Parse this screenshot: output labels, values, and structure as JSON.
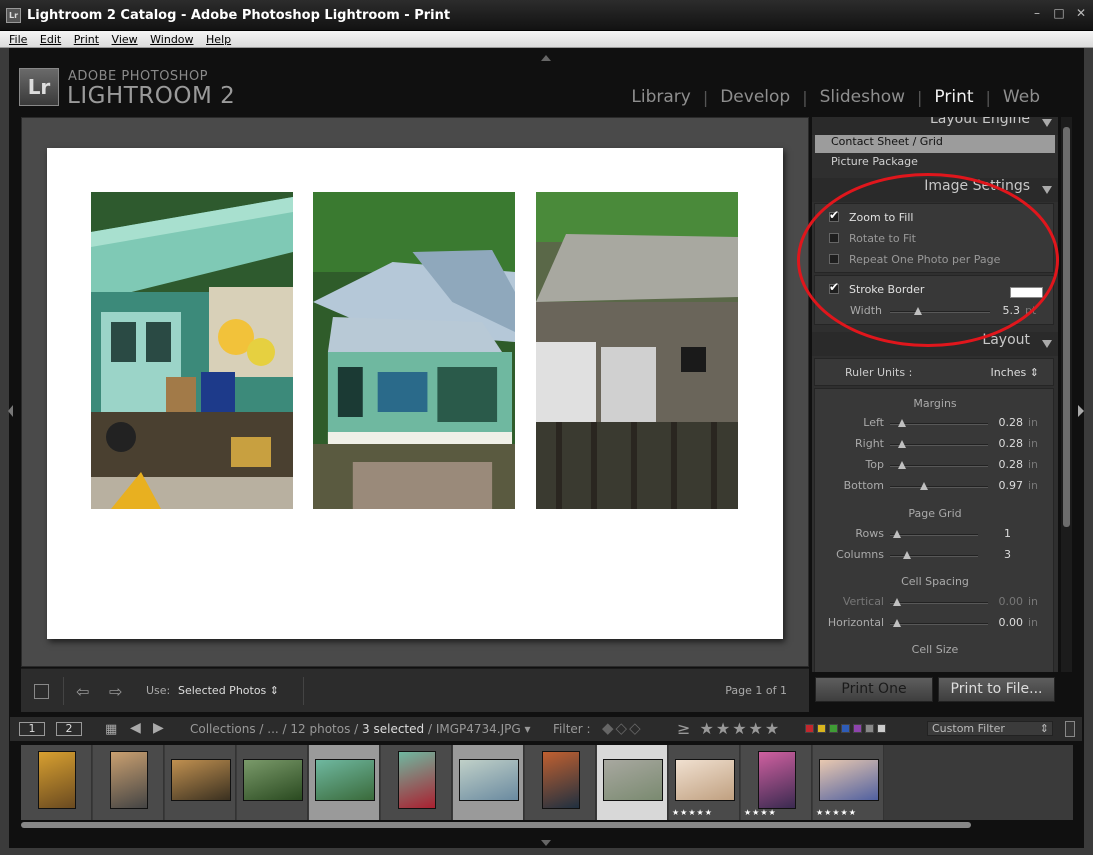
{
  "window": {
    "title": "Lightroom 2 Catalog - Adobe Photoshop Lightroom - Print",
    "app_icon": "Lr"
  },
  "menu": [
    "File",
    "Edit",
    "Print",
    "View",
    "Window",
    "Help"
  ],
  "identity": {
    "logo": "Lr",
    "line1": "ADOBE PHOTOSHOP",
    "line2": "LIGHTROOM 2"
  },
  "modules": [
    {
      "label": "Library",
      "active": false
    },
    {
      "label": "Develop",
      "active": false
    },
    {
      "label": "Slideshow",
      "active": false
    },
    {
      "label": "Print",
      "active": true
    },
    {
      "label": "Web",
      "active": false
    }
  ],
  "toolbar": {
    "use_label": "Use:",
    "use_value": "Selected Photos",
    "page_indicator": "Page 1 of 1"
  },
  "right_panel": {
    "layout_engine": {
      "title": "Layout Engine",
      "options": [
        "Contact Sheet / Grid",
        "Picture Package"
      ],
      "selected": "Contact Sheet / Grid"
    },
    "image_settings": {
      "title": "Image Settings",
      "zoom_to_fill": {
        "label": "Zoom to Fill",
        "checked": true
      },
      "rotate_to_fit": {
        "label": "Rotate to Fit",
        "checked": false
      },
      "repeat_one": {
        "label": "Repeat One Photo per Page",
        "checked": false
      },
      "stroke_border": {
        "label": "Stroke Border",
        "checked": true,
        "color": "#ffffff"
      },
      "width": {
        "label": "Width",
        "value": "5.3",
        "unit": "pt"
      }
    },
    "layout": {
      "title": "Layout",
      "ruler_units_label": "Ruler Units :",
      "ruler_units_value": "Inches",
      "margins_title": "Margins",
      "margins": [
        {
          "label": "Left",
          "value": "0.28",
          "unit": "in",
          "fraction": 0.05
        },
        {
          "label": "Right",
          "value": "0.28",
          "unit": "in",
          "fraction": 0.05
        },
        {
          "label": "Top",
          "value": "0.28",
          "unit": "in",
          "fraction": 0.05
        },
        {
          "label": "Bottom",
          "value": "0.97",
          "unit": "in",
          "fraction": 0.3
        }
      ],
      "page_grid_title": "Page Grid",
      "page_grid": [
        {
          "label": "Rows",
          "value": "1",
          "fraction": 0.0
        },
        {
          "label": "Columns",
          "value": "3",
          "fraction": 0.13
        }
      ],
      "cell_spacing_title": "Cell Spacing",
      "cell_spacing": [
        {
          "label": "Vertical",
          "value": "0.00",
          "unit": "in",
          "fraction": 0.0,
          "dim": true
        },
        {
          "label": "Horizontal",
          "value": "0.00",
          "unit": "in",
          "fraction": 0.0,
          "dim": false
        }
      ],
      "cell_size_title": "Cell Size"
    },
    "print_one": "Print One",
    "print_to_file": "Print to File..."
  },
  "filmstrip_bar": {
    "screen1": "1",
    "screen2": "2",
    "source_prefix": "Collections / ... / 12 photos /",
    "selected_count": "3 selected",
    "filename": "/ IMGP4734.JPG",
    "filter_label": "Filter :",
    "rating_op": "≥",
    "stars": "★★★★★",
    "color_labels": [
      "#c2272d",
      "#d9b51e",
      "#3f9c35",
      "#2e5cb8",
      "#8e44ad",
      "#888888",
      "#cccccc"
    ],
    "custom_filter": "Custom Filter"
  },
  "filmstrip": [
    {
      "stars": "",
      "state": "normal"
    },
    {
      "stars": "",
      "state": "normal"
    },
    {
      "stars": "",
      "state": "normal"
    },
    {
      "stars": "",
      "state": "normal"
    },
    {
      "stars": "",
      "state": "selected"
    },
    {
      "stars": "",
      "state": "normal"
    },
    {
      "stars": "",
      "state": "selected"
    },
    {
      "stars": "",
      "state": "normal"
    },
    {
      "stars": "",
      "state": "active"
    },
    {
      "stars": "★★★★★",
      "state": "normal"
    },
    {
      "stars": "★★★★",
      "state": "normal"
    },
    {
      "stars": "★★★★★",
      "state": "normal"
    }
  ]
}
